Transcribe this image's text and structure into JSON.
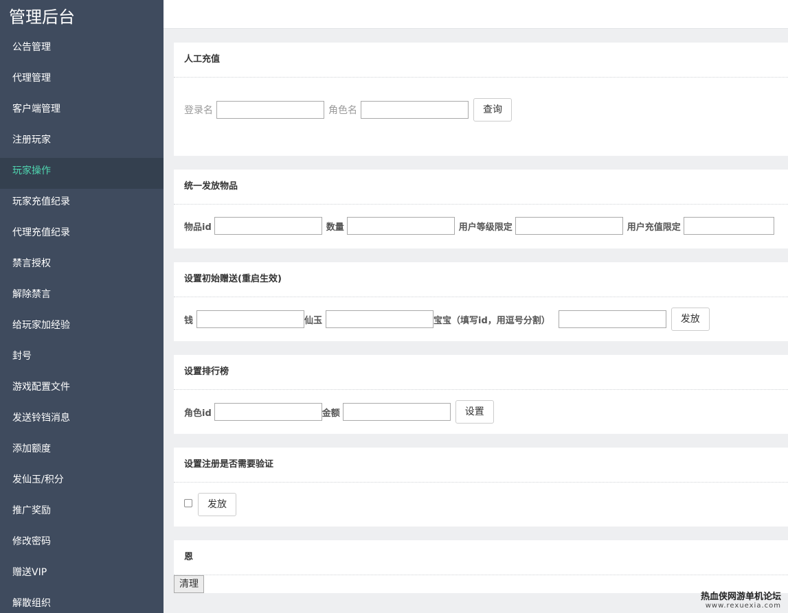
{
  "sidebar": {
    "brand": "管理后台",
    "items": [
      {
        "label": "公告管理"
      },
      {
        "label": "代理管理"
      },
      {
        "label": "客户端管理"
      },
      {
        "label": "注册玩家"
      },
      {
        "label": "玩家操作",
        "active": true
      },
      {
        "label": "玩家充值纪录"
      },
      {
        "label": "代理充值纪录"
      },
      {
        "label": "禁言授权"
      },
      {
        "label": "解除禁言"
      },
      {
        "label": "给玩家加经验"
      },
      {
        "label": "封号"
      },
      {
        "label": "游戏配置文件"
      },
      {
        "label": "发送铃铛消息"
      },
      {
        "label": "添加额度"
      },
      {
        "label": "发仙玉/积分"
      },
      {
        "label": "推广奖励"
      },
      {
        "label": "修改密码"
      },
      {
        "label": "赠送VIP"
      },
      {
        "label": "解散组织"
      }
    ]
  },
  "panels": {
    "recharge": {
      "title": "人工充值",
      "login_label": "登录名",
      "login_value": "",
      "role_label": "角色名",
      "role_value": "",
      "query_button": "查询"
    },
    "items": {
      "title": "统一发放物品",
      "item_id_label": "物品id",
      "qty_label": "数量",
      "level_label": "用户等级限定",
      "charge_label": "用户充值限定"
    },
    "initial": {
      "title": "设置初始赠送(重启生效)",
      "money_label": "钱",
      "jade_label": "仙玉",
      "pet_label": "宝宝（填写id，用逗号分割）",
      "send_button": "发放"
    },
    "ranking": {
      "title": "设置排行榜",
      "role_id_label": "角色id",
      "amount_label": "金额",
      "set_button": "设置"
    },
    "verify": {
      "title": "设置注册是否需要验证",
      "checked": false,
      "send_button": "发放"
    },
    "misc": {
      "title": "恩",
      "clear_button": "清理"
    }
  },
  "watermark": {
    "line1": "热血侠网游单机论坛",
    "line2": "www.rexuexia.com"
  },
  "colors": {
    "sidebar_bg": "#3f4b5e",
    "sidebar_active_bg": "#34404f",
    "sidebar_active_text": "#4fd6b0",
    "page_bg": "#eeeff1"
  }
}
